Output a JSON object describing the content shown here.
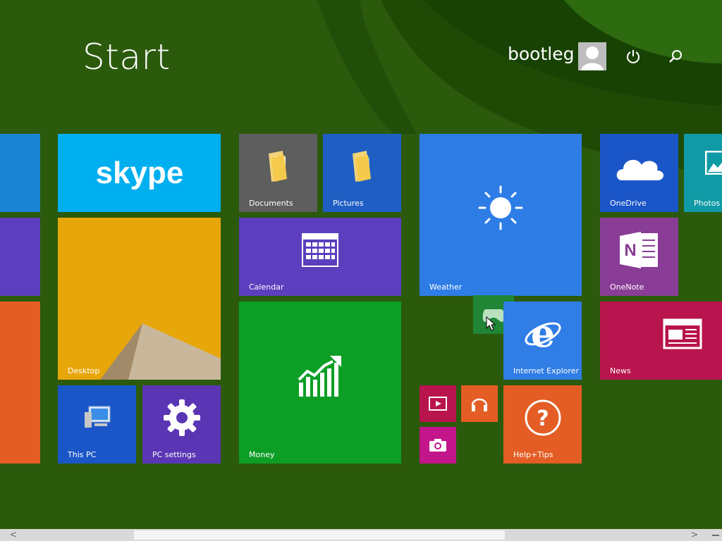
{
  "start": {
    "title": "Start"
  },
  "user": {
    "name": "bootleg"
  },
  "header": {
    "power_icon": "power-icon",
    "search_icon": "search-icon"
  },
  "tiles": {
    "skype": {
      "logo_text": "skype",
      "color": "#00aff0"
    },
    "documents": {
      "label": "Documents",
      "color": "#5e5e5e"
    },
    "pictures": {
      "label": "Pictures",
      "color": "#1f5fc3"
    },
    "calendar": {
      "label": "Calendar",
      "color": "#5b3fbe"
    },
    "desktop": {
      "label": "Desktop",
      "color": "#e7a60a"
    },
    "this_pc": {
      "label": "This PC",
      "color": "#1b56c8"
    },
    "pc_settings": {
      "label": "PC settings",
      "color": "#5a36b5"
    },
    "money": {
      "label": "Money",
      "color": "#0d9e25"
    },
    "weather": {
      "label": "Weather",
      "color": "#2e7de6"
    },
    "internet_explorer": {
      "label": "Internet Explorer",
      "color": "#2f7de5"
    },
    "help_tips": {
      "label": "Help+Tips",
      "color": "#e35d25"
    },
    "onedrive": {
      "label": "OneDrive",
      "color": "#1b56c8"
    },
    "photos": {
      "label": "Photos",
      "color": "#0f9aa5"
    },
    "onenote": {
      "label": "OneNote",
      "color": "#8a3d96"
    },
    "news": {
      "label": "News",
      "color": "#b8144d"
    }
  },
  "scrollbar": {
    "left_arrow": "<",
    "right_arrow": ">"
  }
}
